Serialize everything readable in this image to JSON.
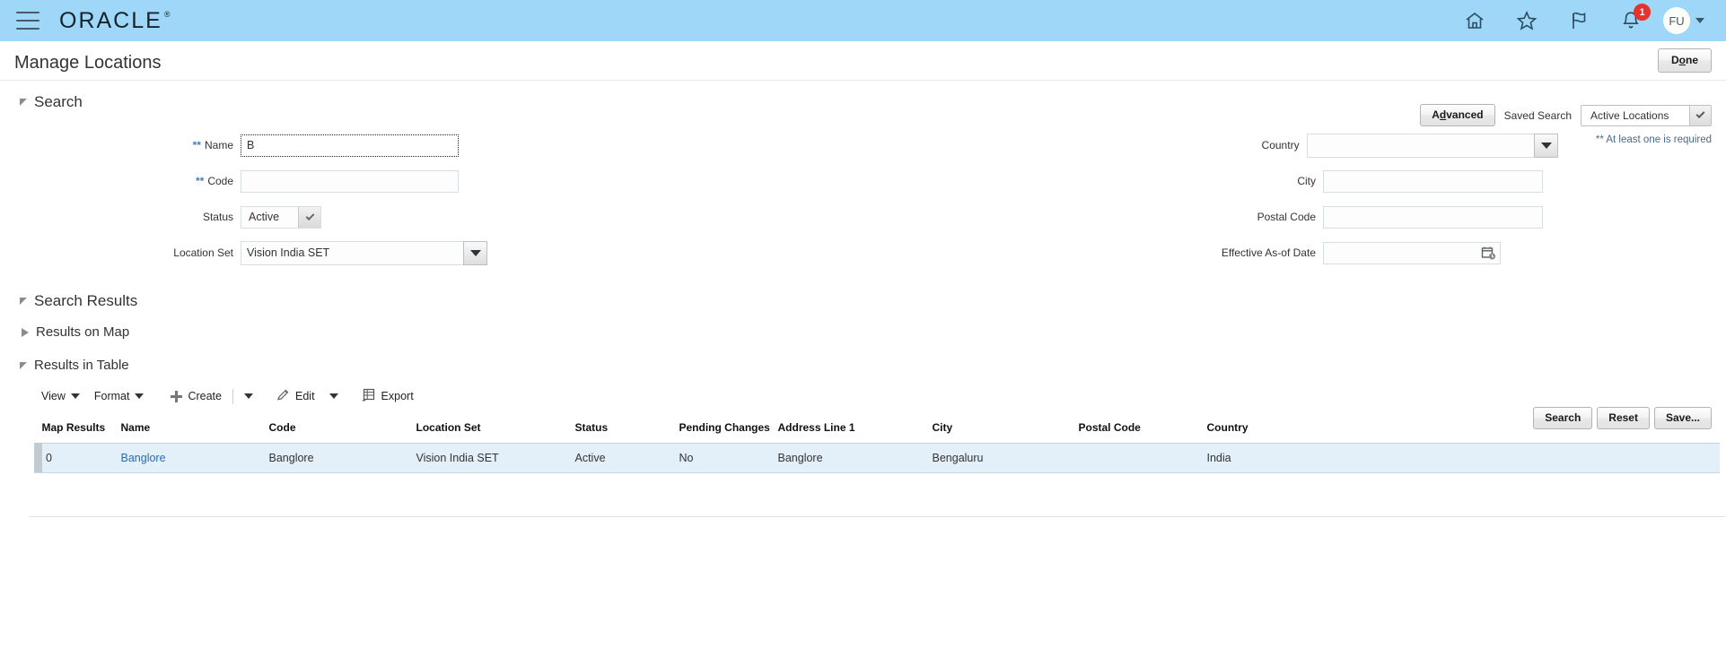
{
  "global_header": {
    "logo_text": "ORACLE",
    "logo_mark": "®",
    "menu_icon": "hamburger-icon",
    "icons": [
      {
        "name": "home-icon",
        "label": "Home"
      },
      {
        "name": "favorites-star-icon",
        "label": "Favorites and Recent Items"
      },
      {
        "name": "watchlist-flag-icon",
        "label": "Watchlist"
      },
      {
        "name": "notifications-bell-icon",
        "label": "Notifications",
        "badge": "1"
      }
    ],
    "avatar_initials": "FU"
  },
  "page": {
    "title": "Manage Locations",
    "done_label_pre": "D",
    "done_label_key": "o",
    "done_label_post": "ne",
    "done_label": "Done"
  },
  "search_section": {
    "title": "Search",
    "advanced_pre": "A",
    "advanced_key": "d",
    "advanced_post": "vanced",
    "advanced_label": "Advanced",
    "saved_search_label": "Saved Search",
    "saved_search_value": "Active Locations",
    "required_note": "** At least one is required",
    "fields": {
      "name": {
        "label": "Name",
        "value": "B",
        "required_mark": "**"
      },
      "code": {
        "label": "Code",
        "value": "",
        "required_mark": "**"
      },
      "status": {
        "label": "Status",
        "value": "Active"
      },
      "location_set": {
        "label": "Location Set",
        "value": "Vision India SET"
      },
      "country": {
        "label": "Country",
        "value": ""
      },
      "city": {
        "label": "City",
        "value": ""
      },
      "postal_code": {
        "label": "Postal Code",
        "value": ""
      },
      "effective_date": {
        "label": "Effective As-of Date",
        "value": ""
      }
    },
    "buttons": {
      "search": "Search",
      "reset": "Reset",
      "save": "Save..."
    }
  },
  "results": {
    "search_results_title": "Search Results",
    "results_on_map_title": "Results on Map",
    "results_in_table_title": "Results in Table",
    "toolbar": {
      "view": "View",
      "format": "Format",
      "create": "Create",
      "edit": "Edit",
      "export": "Export"
    },
    "table": {
      "columns": [
        "Map Results",
        "Name",
        "Code",
        "Location Set",
        "Status",
        "Pending Changes",
        "Address Line 1",
        "City",
        "Postal Code",
        "Country"
      ],
      "rows": [
        {
          "map_results": "0",
          "name": "Banglore",
          "code": "Banglore",
          "location_set": "Vision India SET",
          "status": "Active",
          "pending_changes": "No",
          "address_line_1": "Banglore",
          "city": "Bengaluru",
          "postal_code": "",
          "country": "India"
        }
      ]
    }
  },
  "colors": {
    "header_bg": "#9ed7f8",
    "link": "#2a6bb5",
    "selected_row": "#e3eff9",
    "badge": "#e3342f",
    "required_mark": "#4a7fb5"
  }
}
